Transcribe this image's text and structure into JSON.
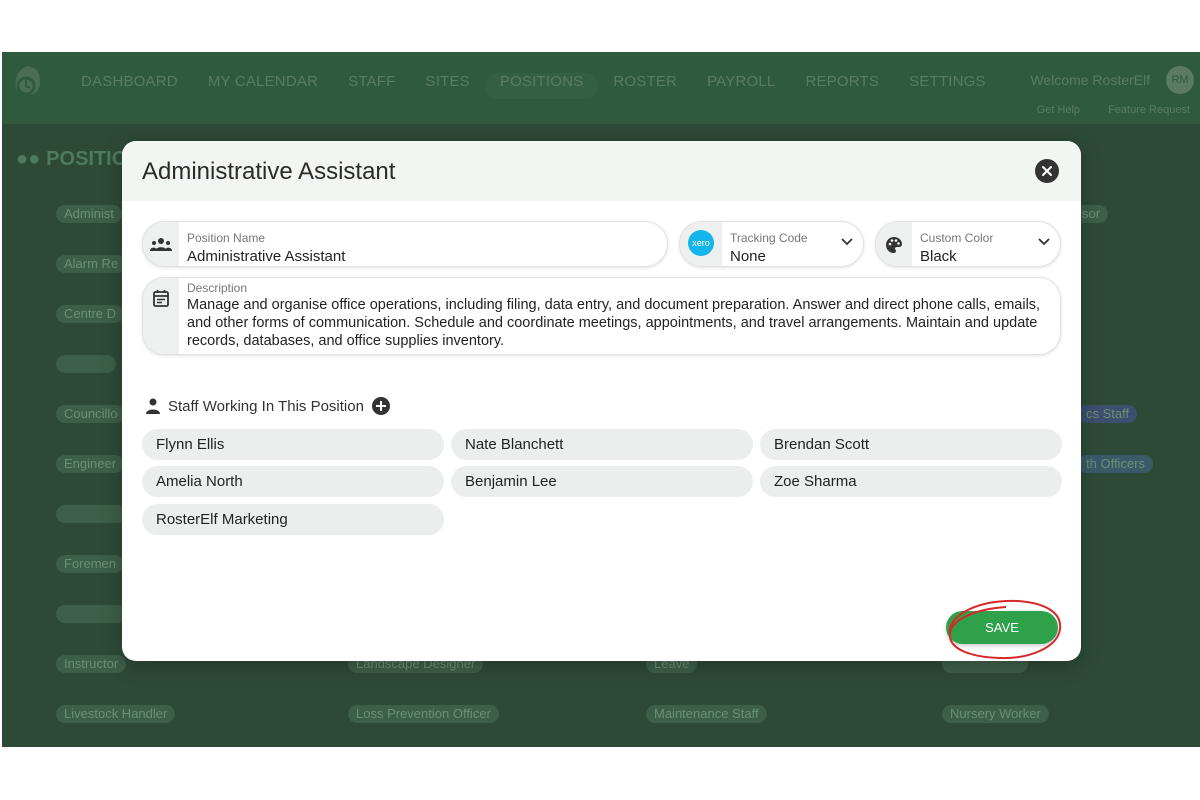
{
  "app": {
    "nav": [
      "DASHBOARD",
      "MY CALENDAR",
      "STAFF",
      "SITES",
      "POSITIONS",
      "ROSTER",
      "PAYROLL",
      "REPORTS",
      "SETTINGS"
    ],
    "welcome": "Welcome RosterElf",
    "avatar": "RM",
    "get_help": "Get Help",
    "feature_request": "Feature Request",
    "page_title": "POSITIO",
    "bg_positions": {
      "c1": [
        "Administ",
        "Alarm Re",
        "Centre D",
        "",
        "Councillo",
        "Engineer",
        "",
        "Foremen",
        "",
        "Instructor",
        "Livestock Handler"
      ],
      "c2": [
        "Landscape Designer",
        "Loss Prevention Officer"
      ],
      "c3": [
        "Leave",
        "Maintenance Staff"
      ],
      "c4": [
        "sor",
        "cs Staff",
        "th Officers",
        "",
        "Nursery Worker"
      ]
    }
  },
  "modal": {
    "title": "Administrative Assistant",
    "position_name": {
      "label": "Position Name",
      "value": "Administrative Assistant"
    },
    "tracking_code": {
      "label": "Tracking Code",
      "value": "None",
      "badge": "xero"
    },
    "custom_color": {
      "label": "Custom Color",
      "value": "Black"
    },
    "description": {
      "label": "Description",
      "value": "Manage and organise office operations, including filing, data entry, and document preparation. Answer and direct phone calls, emails, and other forms of communication. Schedule and coordinate meetings, appointments, and travel arrangements. Maintain and update records, databases, and office supplies inventory."
    },
    "staff_header": "Staff Working In This Position",
    "staff": [
      "Flynn Ellis",
      "Nate Blanchett",
      "Brendan Scott",
      "Amelia North",
      "Benjamin Lee",
      "Zoe Sharma",
      "RosterElf Marketing"
    ],
    "save_label": "SAVE"
  },
  "colors": {
    "accent": "#2fa14a",
    "annotation": "#d62828",
    "xero": "#13b5ea"
  }
}
